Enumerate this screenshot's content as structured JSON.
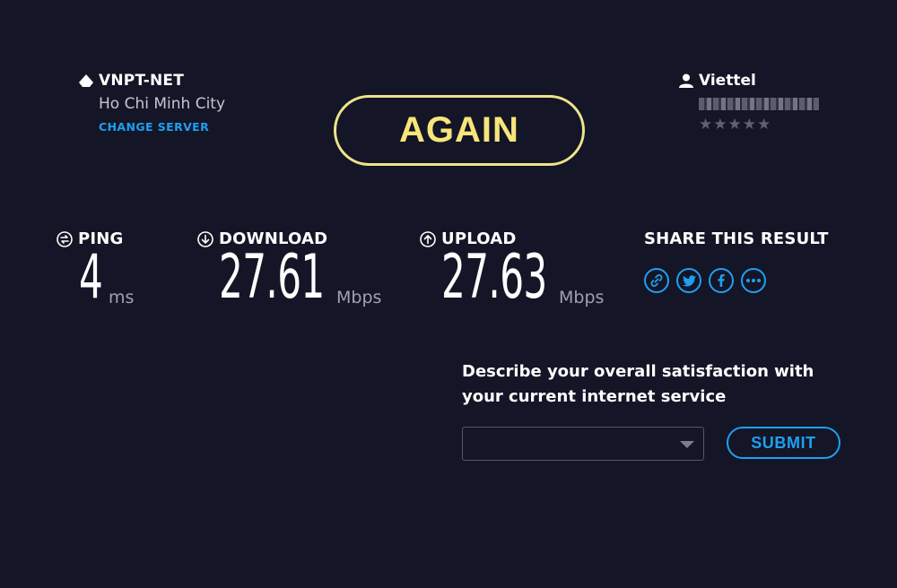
{
  "server": {
    "isp": "VNPT-NET",
    "city": "Ho Chi Minh City",
    "change_label": "CHANGE SERVER"
  },
  "again_label": "AGAIN",
  "provider": {
    "name": "Viettel",
    "rating_stars": "★★★★★"
  },
  "metrics": {
    "ping": {
      "label": "PING",
      "value": "4",
      "unit": "ms"
    },
    "download": {
      "label": "DOWNLOAD",
      "value": "27.61",
      "unit": "Mbps"
    },
    "upload": {
      "label": "UPLOAD",
      "value": "27.63",
      "unit": "Mbps"
    }
  },
  "share": {
    "title": "SHARE THIS RESULT",
    "icons": [
      "link-icon",
      "twitter-icon",
      "facebook-icon",
      "more-icon"
    ]
  },
  "survey": {
    "question": "Describe your overall satisfaction with your current internet service",
    "selected": "",
    "submit_label": "SUBMIT"
  },
  "colors": {
    "background": "#141526",
    "accent_blue": "#1da0f2",
    "again_yellow": "#f7e57a",
    "muted": "#9fa0b0"
  }
}
